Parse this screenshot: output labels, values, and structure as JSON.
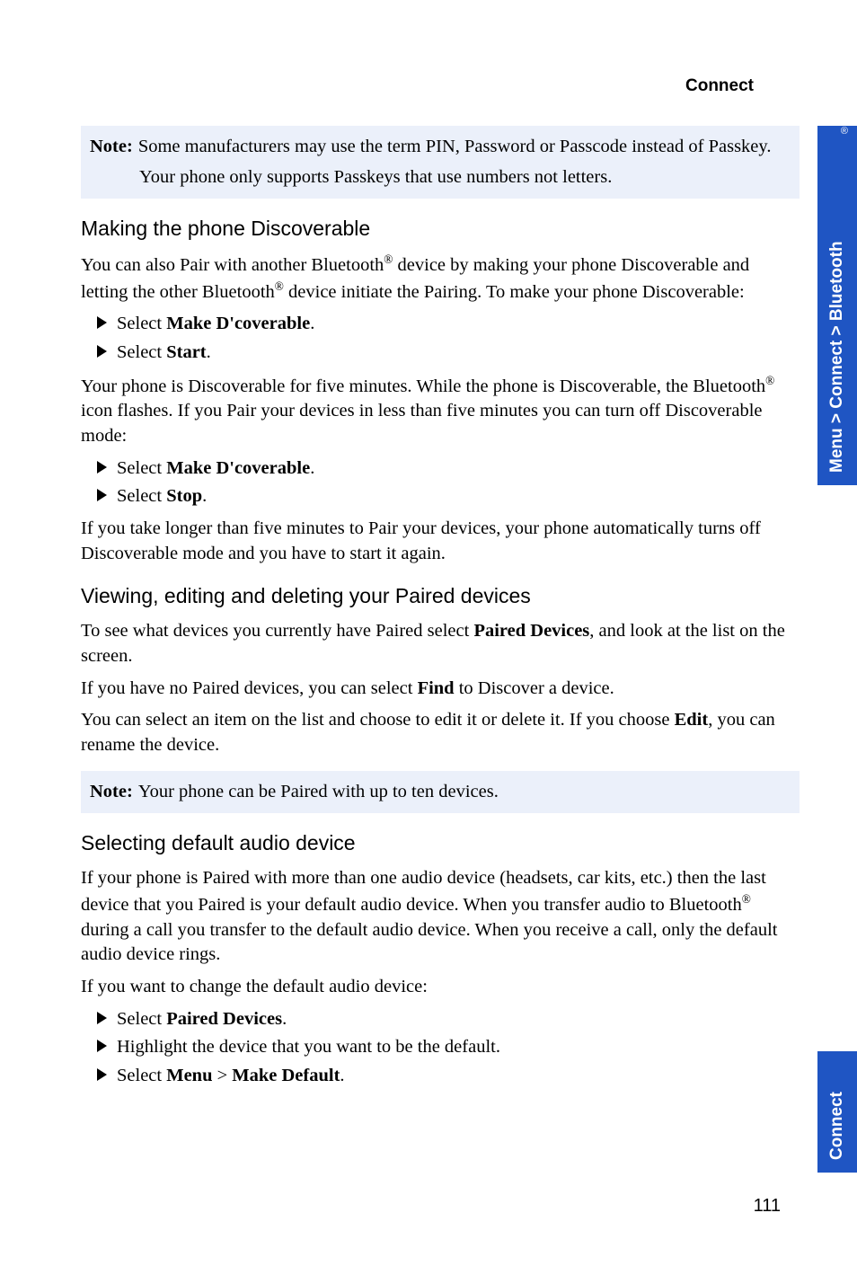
{
  "header": {
    "section": "Connect"
  },
  "sideTabs": {
    "breadcrumb": "Menu > Connect > Bluetooth",
    "chapter": "Connect"
  },
  "note1": {
    "label": "Note:",
    "body": "Some manufacturers may use the term PIN, Password or Passcode instead of Passkey.",
    "extra": "Your phone only supports Passkeys that use numbers not letters."
  },
  "sec1": {
    "title": "Making the phone Discoverable",
    "p1a": "You can also Pair with another Bluetooth",
    "p1b": " device by making your phone Discoverable and letting the other Bluetooth",
    "p1c": " device initiate the Pairing. To make your phone Discoverable:",
    "li1_pre": "Select ",
    "li1_bold": "Make D'coverable",
    "li1_post": ".",
    "li2_pre": "Select ",
    "li2_bold": "Start",
    "li2_post": ".",
    "p2a": "Your phone is Discoverable for five minutes. While the phone is Discoverable, the Bluetooth",
    "p2b": " icon flashes. If you Pair your devices in less than five minutes you can turn off Discoverable mode:",
    "li3_pre": "Select ",
    "li3_bold": "Make D'coverable",
    "li3_post": ".",
    "li4_pre": "Select ",
    "li4_bold": "Stop",
    "li4_post": ".",
    "p3": "If you take longer than five minutes to Pair your devices, your phone automatically turns off Discoverable mode and you have to start it again."
  },
  "sec2": {
    "title": "Viewing, editing and deleting your Paired devices",
    "p1_pre": "To see what devices you currently have Paired select ",
    "p1_bold": "Paired Devices",
    "p1_post": ", and look at the list on the screen.",
    "p2_pre": "If you have no Paired devices, you can select ",
    "p2_bold": "Find",
    "p2_post": " to Discover a device.",
    "p3_pre": "You can select an item on the list and choose to edit it or delete it. If you choose ",
    "p3_bold": "Edit",
    "p3_post": ", you can rename the device."
  },
  "note2": {
    "label": "Note:",
    "body": "Your phone can be Paired with up to ten devices."
  },
  "sec3": {
    "title": "Selecting default audio device",
    "p1a": "If your phone is Paired with more than one audio device (headsets, car kits, etc.) then the last device that you Paired is your default audio device. When you transfer audio to Bluetooth",
    "p1b": " during a call you transfer to the default audio device. When you receive a call, only the default audio device rings.",
    "p2": "If you want to change the default audio device:",
    "li1_pre": "Select ",
    "li1_bold": "Paired Devices",
    "li1_post": ".",
    "li2": "Highlight the device that you want to be the default.",
    "li3_pre": "Select ",
    "li3_b1": "Menu",
    "li3_mid": " > ",
    "li3_b2": "Make Default",
    "li3_post": "."
  },
  "pageNumber": "111",
  "reg": "®"
}
